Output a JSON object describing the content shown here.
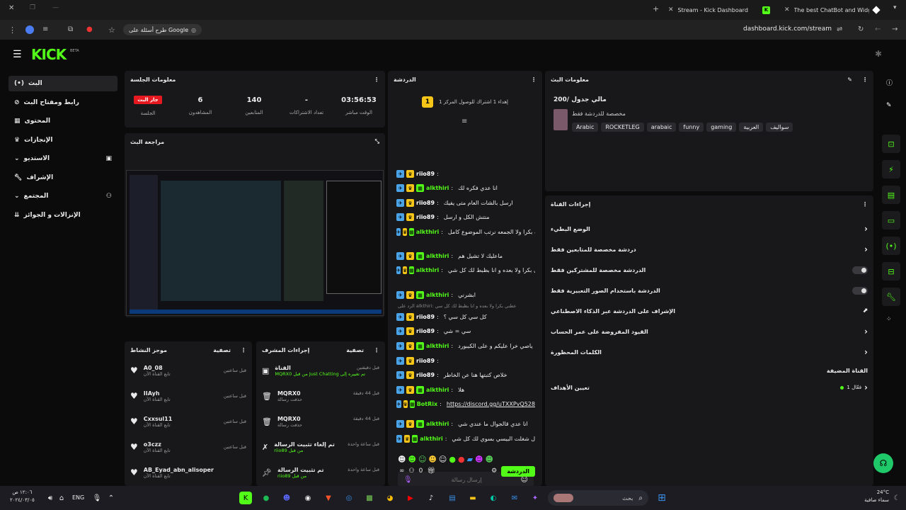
{
  "browser": {
    "tabs": [
      {
        "label": "Stream - Kick Dashboard"
      },
      {
        "label": "The best ChatBot and Widgets"
      }
    ],
    "url": "dashboard.kick.com/stream",
    "google_chip": "طرح أسئلة على Google"
  },
  "brand": {
    "logo": "KICK",
    "beta": "BETA",
    "accent": "#53fc18"
  },
  "sidebar": {
    "items": [
      {
        "label": "البث"
      },
      {
        "label": "رابط ومفتاح البث"
      },
      {
        "label": "المحتوى"
      },
      {
        "label": "الإنجازات"
      },
      {
        "label": "الاستديو"
      },
      {
        "label": "الإشراف"
      },
      {
        "label": "المجتمع"
      },
      {
        "label": "الإنزالات و الجوائز"
      }
    ]
  },
  "session": {
    "title": "معلومات الجلسة",
    "live_badge": "جار البث",
    "live_label": "الجلسة",
    "stats": [
      {
        "value": "6",
        "label": "المشاهدون"
      },
      {
        "value": "140",
        "label": "المتابعين"
      },
      {
        "value": "-",
        "label": "تعداد الاشتراكات"
      },
      {
        "value": "03:56:53",
        "label": "الوقت مباشر"
      }
    ]
  },
  "preview": {
    "title": "مراجعة البث"
  },
  "activity": {
    "title": "موجز النشاط",
    "filter": "تصفية",
    "items": [
      {
        "name": "A0_08",
        "sub": "تابع القناة الآن",
        "time": "قبل ساعتين"
      },
      {
        "name": "IIAyh",
        "sub": "تابع القناة الآن",
        "time": "قبل ساعتين"
      },
      {
        "name": "Cxxsul11",
        "sub": "تابع القناة الآن",
        "time": "قبل ساعتين"
      },
      {
        "name": "o3czz",
        "sub": "تابع القناة الآن",
        "time": "قبل ساعتين"
      },
      {
        "name": "AB_Eyad_abn_alisoper",
        "sub": "تابع القناة الآن",
        "time": "قبل ساعتين"
      }
    ]
  },
  "modactions": {
    "title": "إجراءات المشرف",
    "filter": "تصفية",
    "items": [
      {
        "name": "القناة",
        "sub": "MQRX0 من قبل Just Chatting تم تغييره إلى",
        "time": "قبل دقيقتين"
      },
      {
        "name": "MQRX0",
        "sub": "حذفت رسالة",
        "time": "قبل 44 دقيقة"
      },
      {
        "name": "MQRX0",
        "sub": "حذفت رسالة",
        "time": "قبل 44 دقيقة"
      },
      {
        "name": "تم إلغاء تثبيت الرسالة",
        "sub": "riio89 من قبل",
        "time": "قبل ساعة واحدة"
      },
      {
        "name": "تم تثبيت الرسالة",
        "sub": "riio89 من قبل",
        "time": "قبل ساعة واحدة"
      }
    ]
  },
  "chat": {
    "title": "الدردشة",
    "pinned": "إهداء 1 اشتراك للوصول المركز 1",
    "pin_rank": "1",
    "messages": [
      {
        "user": "riio89",
        "color": "#ffffff",
        "text": ""
      },
      {
        "user": "alkthiri",
        "color": "#53fc18",
        "text": "انا عدي فكره لك"
      },
      {
        "user": "riio89",
        "color": "#ffffff",
        "text": "ارسل بالشات العام متى يفيك"
      },
      {
        "user": "riio89",
        "color": "#ffffff",
        "text": "منتش الكل و ارسل"
      },
      {
        "user": "alkthiri",
        "color": "#53fc18",
        "text": "شرايك بكرا ولا الجمعه نرتب الموضوع كامل"
      },
      {
        "user": "alkthiri",
        "color": "#53fc18",
        "text": "ماعليك لا تشيل هم"
      },
      {
        "user": "alkthiri",
        "color": "#53fc18",
        "text": "عطني بكرا ولا بعده و انا بظبط لك كل شي"
      },
      {
        "user": "alkthiri",
        "color": "#53fc18",
        "text": "ابشرني"
      },
      {
        "user": "riio89",
        "color": "#ffffff",
        "text": "كل سي كل سي ؟"
      },
      {
        "user": "riio89",
        "color": "#ffffff",
        "text": "سي = شي"
      },
      {
        "user": "alkthiri",
        "color": "#53fc18",
        "text": "ياصي خرا عليكم و على الكيبورد"
      },
      {
        "user": "riio89",
        "color": "#ffffff",
        "text": ""
      },
      {
        "user": "riio89",
        "color": "#ffffff",
        "text": "خلاص كتبتها هنا عن الخاطر"
      },
      {
        "user": "alkthiri",
        "color": "#53fc18",
        "text": "هلا"
      },
      {
        "user": "BotRix",
        "color": "#53fc18",
        "text": "https://discord.gg/uTXXPvQ528"
      },
      {
        "user": "alkthiri",
        "color": "#53fc18",
        "text": "انا عدي قالجوال ما عندي شي"
      },
      {
        "user": "alkthiri",
        "color": "#53fc18",
        "text": "ل شغلت البيسي بسوي لك كل شي"
      }
    ],
    "reply_hint": "الرد على alkthiri: عطني بكرا ولا بعده و انا بظبط لك كل سي",
    "input_placeholder": "إرسال رسالة",
    "send_label": "الدردشة",
    "count": "0"
  },
  "streaminfo": {
    "title": "معلومات البث",
    "stream_title": "مالي جدول /200",
    "category": "مخصصة للدردشة فقط",
    "tags": [
      "Arabic",
      "ROCKETLEG",
      "arabaic",
      "funny",
      "gaming",
      "العربية",
      "سواليف"
    ]
  },
  "channelactions": {
    "title": "إجراءات القناة",
    "rows": [
      {
        "label": "الوضع البطيء"
      },
      {
        "label": "دردشة مخصصة للمتابعين فقط"
      },
      {
        "label": "الدردشة مخصصة للمشتركين فقط"
      },
      {
        "label": "الدردشة باستخدام الصور التعبيرية فقط"
      },
      {
        "label": "الإشراف على الدردشة عبر الذكاء الاصطناعي"
      },
      {
        "label": "القيود المفروضة على عمر الحساب"
      },
      {
        "label": "الكلمات المحظورة"
      }
    ],
    "section": "القناة المضيفة",
    "goal_label": "تعيين الأهداف",
    "goal_status": "فعّال 1"
  },
  "taskbar": {
    "time": "١٢:٠٦ ص",
    "date": "٢٠٢٤/٠٣/٠٥",
    "lang": "ENG",
    "search": "بحث",
    "weather_temp": "24°C",
    "weather_desc": "سماء صافية"
  }
}
